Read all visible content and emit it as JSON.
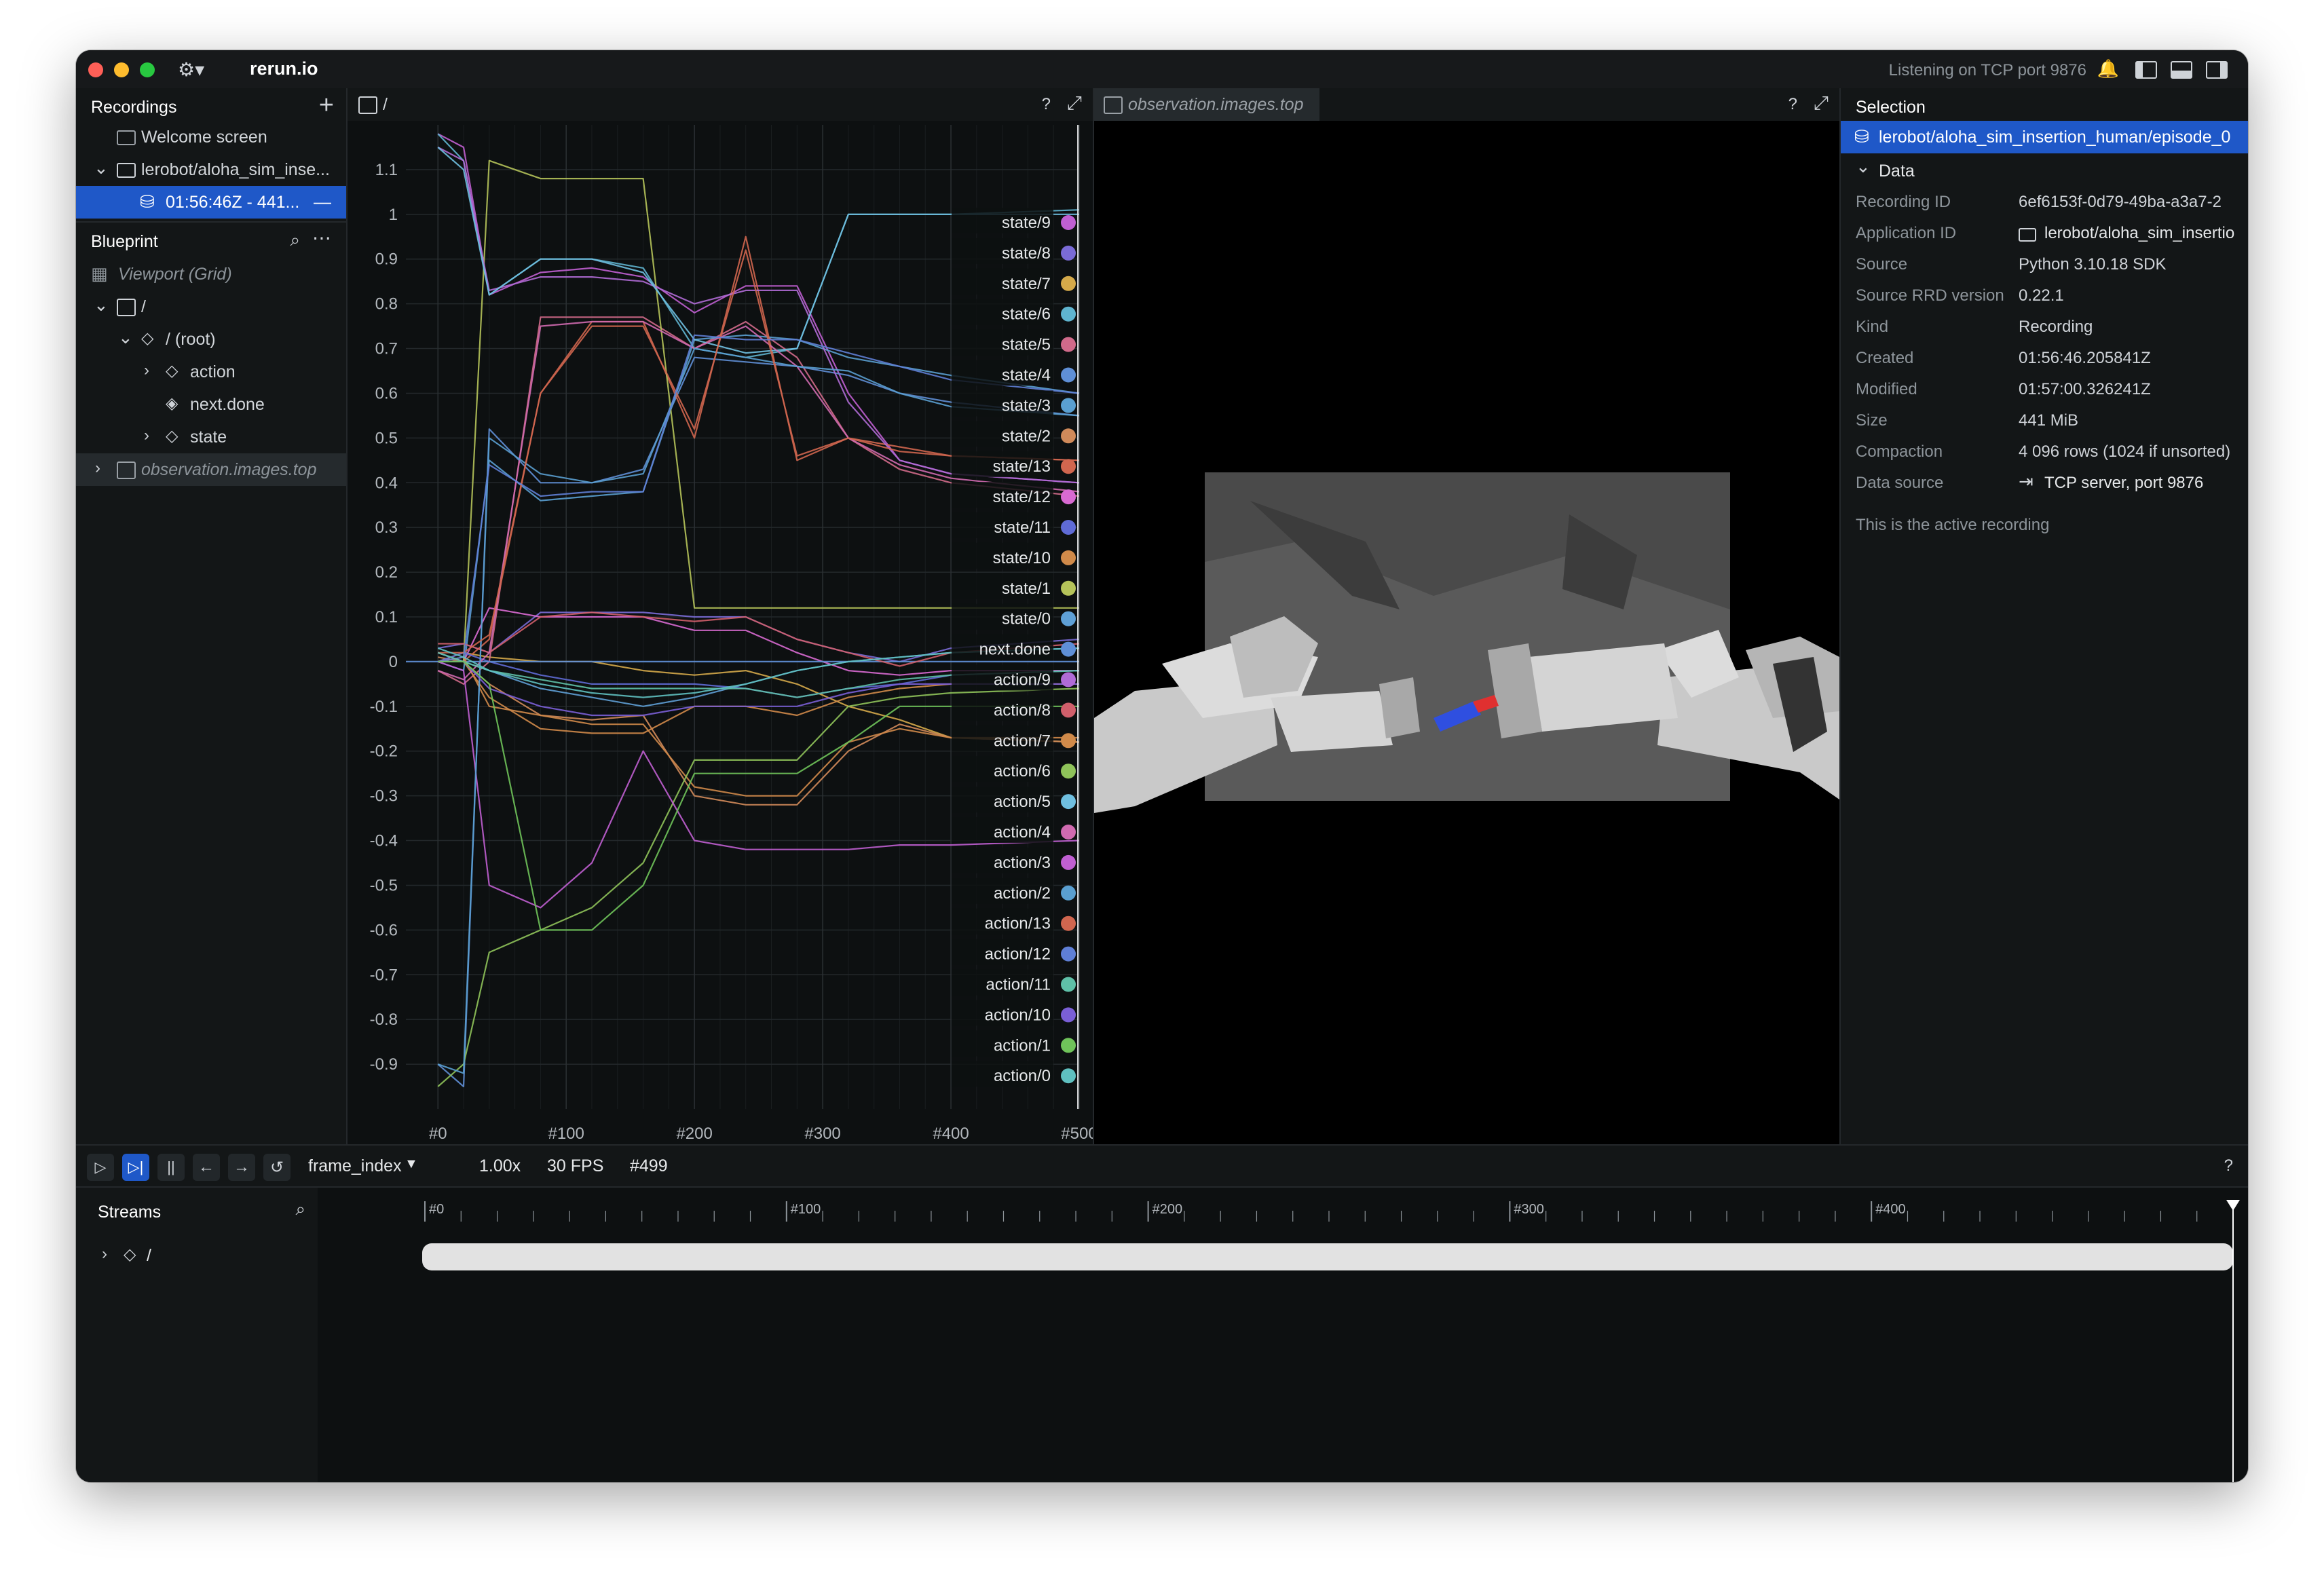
{
  "app": {
    "title": "rerun.io",
    "status": "Listening on TCP port 9876"
  },
  "recordings": {
    "title": "Recordings",
    "items": [
      {
        "label": "Welcome screen"
      },
      {
        "label": "lerobot/aloha_sim_inse..."
      },
      {
        "label": "01:56:46Z - 441..."
      }
    ]
  },
  "blueprint": {
    "title": "Blueprint",
    "items": [
      {
        "label": "Viewport (Grid)"
      },
      {
        "label": "/"
      },
      {
        "label": "/ (root)"
      },
      {
        "label": "action"
      },
      {
        "label": "next.done"
      },
      {
        "label": "state"
      },
      {
        "label": "observation.images.top"
      }
    ]
  },
  "plot_view": {
    "tab": "/",
    "help": "?"
  },
  "image_view": {
    "tab": "observation.images.top",
    "help": "?"
  },
  "chart_data": {
    "type": "line",
    "title": "",
    "xlabel": "",
    "ylabel": "",
    "xlim": [
      -25,
      500
    ],
    "ylim": [
      -1.0,
      1.2
    ],
    "x_ticks": [
      "#0",
      "#100",
      "#200",
      "#300",
      "#400",
      "#500"
    ],
    "y_ticks": [
      "1.1",
      "1",
      "0.9",
      "0.8",
      "0.7",
      "0.6",
      "0.5",
      "0.4",
      "0.3",
      "0.2",
      "0.1",
      "0",
      "-0.1",
      "-0.2",
      "-0.3",
      "-0.4",
      "-0.5",
      "-0.6",
      "-0.7",
      "-0.8",
      "-0.9"
    ],
    "grid": true,
    "legend_placement": "right",
    "series": [
      {
        "name": "state/9",
        "color": "#c05fd2",
        "x": [
          0,
          20,
          40,
          80,
          120,
          160,
          200,
          240,
          280,
          320,
          360,
          400,
          500
        ],
        "y": [
          1.18,
          1.15,
          0.82,
          0.87,
          0.88,
          0.86,
          0.78,
          0.84,
          0.84,
          0.6,
          0.45,
          0.42,
          0.4
        ]
      },
      {
        "name": "state/8",
        "color": "#7a6bd6",
        "x": [
          0,
          20,
          40,
          80,
          120,
          160,
          200,
          240,
          280,
          320,
          360,
          400,
          500
        ],
        "y": [
          0.03,
          0.04,
          0.02,
          0.11,
          0.11,
          0.11,
          0.1,
          0.1,
          0.05,
          0.02,
          0.0,
          0.03,
          0.05
        ]
      },
      {
        "name": "state/7",
        "color": "#d4a94a",
        "x": [
          0,
          20,
          40,
          80,
          120,
          160,
          200,
          240,
          280,
          320,
          360,
          400,
          500
        ],
        "y": [
          0.0,
          0.02,
          0.01,
          0.0,
          0.0,
          -0.02,
          -0.03,
          -0.02,
          -0.05,
          -0.1,
          -0.13,
          -0.17,
          -0.18
        ]
      },
      {
        "name": "state/6",
        "color": "#5fb4cf",
        "x": [
          0,
          20,
          40,
          80,
          120,
          160,
          200,
          240,
          280,
          320,
          360,
          400,
          500
        ],
        "y": [
          1.18,
          1.12,
          0.82,
          0.9,
          0.9,
          0.88,
          0.7,
          0.68,
          0.7,
          1.0,
          1.0,
          1.0,
          1.01
        ]
      },
      {
        "name": "state/5",
        "color": "#d06a8a",
        "x": [
          0,
          20,
          40,
          80,
          120,
          160,
          200,
          240,
          280,
          320,
          360,
          400,
          500
        ],
        "y": [
          -0.02,
          -0.05,
          0.0,
          0.77,
          0.77,
          0.77,
          0.7,
          0.76,
          0.68,
          0.5,
          0.43,
          0.4,
          0.37
        ]
      },
      {
        "name": "state/4",
        "color": "#5f8fd6",
        "x": [
          0,
          20,
          40,
          80,
          120,
          160,
          200,
          240,
          280,
          320,
          360,
          400,
          500
        ],
        "y": [
          -0.9,
          -0.95,
          0.52,
          0.4,
          0.4,
          0.43,
          0.68,
          0.67,
          0.66,
          0.64,
          0.6,
          0.58,
          0.55
        ]
      },
      {
        "name": "state/3",
        "color": "#5a9fd0",
        "x": [
          0,
          20,
          40,
          80,
          120,
          160,
          200,
          240,
          280,
          320,
          360,
          400,
          500
        ],
        "y": [
          0.0,
          -0.02,
          0.45,
          0.36,
          0.37,
          0.38,
          0.72,
          0.73,
          0.72,
          0.68,
          0.66,
          0.64,
          0.6
        ]
      },
      {
        "name": "state/2",
        "color": "#d08a5a",
        "x": [
          0,
          20,
          40,
          80,
          120,
          160,
          200,
          240,
          280,
          320,
          360,
          400,
          500
        ],
        "y": [
          0.01,
          0.0,
          -0.05,
          -0.12,
          -0.13,
          -0.12,
          -0.3,
          -0.32,
          -0.32,
          -0.2,
          -0.14,
          -0.17,
          -0.18
        ]
      },
      {
        "name": "state/13",
        "color": "#d0664f",
        "x": [
          0,
          20,
          40,
          80,
          120,
          160,
          200,
          240,
          280,
          320,
          360,
          400,
          500
        ],
        "y": [
          0.02,
          0.0,
          0.05,
          0.6,
          0.76,
          0.76,
          0.5,
          0.95,
          0.45,
          0.5,
          0.48,
          0.46,
          0.45
        ]
      },
      {
        "name": "state/12",
        "color": "#d86ad2",
        "x": [
          0,
          20,
          40,
          80,
          120,
          160,
          200,
          240,
          280,
          320,
          360,
          400,
          500
        ],
        "y": [
          0.02,
          0.0,
          0.12,
          0.1,
          0.1,
          0.1,
          0.07,
          0.07,
          0.02,
          -0.02,
          -0.03,
          -0.02,
          -0.02
        ]
      },
      {
        "name": "state/11",
        "color": "#5f6bd6",
        "x": [
          0,
          20,
          40,
          80,
          120,
          160,
          200,
          240,
          280,
          320,
          360,
          400,
          500
        ],
        "y": [
          0.0,
          0.02,
          0.0,
          -0.03,
          -0.05,
          -0.05,
          -0.05,
          -0.06,
          -0.08,
          -0.06,
          -0.05,
          -0.03,
          -0.02
        ]
      },
      {
        "name": "state/10",
        "color": "#d08a4a",
        "x": [
          0,
          20,
          40,
          80,
          120,
          160,
          200,
          240,
          280,
          320,
          360,
          400,
          500
        ],
        "y": [
          0.0,
          0.0,
          -0.08,
          -0.15,
          -0.16,
          -0.16,
          -0.1,
          -0.1,
          -0.12,
          -0.08,
          -0.06,
          -0.05,
          -0.05
        ]
      },
      {
        "name": "state/1",
        "color": "#b5c35a",
        "x": [
          0,
          20,
          40,
          80,
          120,
          160,
          200,
          240,
          280,
          320,
          360,
          400,
          500
        ],
        "y": [
          0.0,
          0.0,
          1.12,
          1.08,
          1.08,
          1.08,
          0.12,
          0.12,
          0.12,
          0.12,
          0.12,
          0.12,
          0.12
        ]
      },
      {
        "name": "state/0",
        "color": "#5fa0d6",
        "x": [
          0,
          20,
          40,
          80,
          120,
          160,
          200,
          240,
          280,
          320,
          360,
          400,
          500
        ],
        "y": [
          0.02,
          0.0,
          -0.02,
          -0.06,
          -0.08,
          -0.1,
          -0.08,
          -0.05,
          -0.02,
          0.0,
          0.01,
          0.02,
          0.03
        ]
      },
      {
        "name": "next.done",
        "color": "#5f8fd6",
        "x": [
          -25,
          500
        ],
        "y": [
          0.0,
          0.0
        ]
      },
      {
        "name": "action/9",
        "color": "#b06bd6",
        "x": [
          0,
          20,
          40,
          80,
          120,
          160,
          200,
          240,
          280,
          320,
          360,
          400,
          500
        ],
        "y": [
          1.15,
          1.12,
          0.83,
          0.86,
          0.86,
          0.85,
          0.8,
          0.83,
          0.83,
          0.58,
          0.45,
          0.42,
          0.4
        ]
      },
      {
        "name": "action/8",
        "color": "#d05f6b",
        "x": [
          0,
          20,
          40,
          80,
          120,
          160,
          200,
          240,
          280,
          320,
          360,
          400,
          500
        ],
        "y": [
          0.04,
          0.04,
          0.02,
          0.1,
          0.11,
          0.1,
          0.09,
          0.1,
          0.05,
          0.02,
          -0.01,
          0.02,
          0.04
        ]
      },
      {
        "name": "action/7",
        "color": "#d08a4a",
        "x": [
          0,
          20,
          40,
          80,
          120,
          160,
          200,
          240,
          280,
          320,
          360,
          400,
          500
        ],
        "y": [
          0.0,
          0.01,
          -0.1,
          -0.12,
          -0.14,
          -0.14,
          -0.28,
          -0.3,
          -0.3,
          -0.18,
          -0.15,
          -0.17,
          -0.17
        ]
      },
      {
        "name": "action/6",
        "color": "#8fc35a",
        "x": [
          0,
          20,
          40,
          80,
          120,
          160,
          200,
          240,
          280,
          320,
          360,
          400,
          500
        ],
        "y": [
          -0.95,
          -0.9,
          -0.65,
          -0.6,
          -0.55,
          -0.45,
          -0.22,
          -0.22,
          -0.22,
          -0.1,
          -0.08,
          -0.07,
          -0.06
        ]
      },
      {
        "name": "action/5",
        "color": "#6fbfe0",
        "x": [
          0,
          20,
          40,
          80,
          120,
          160,
          200,
          240,
          280,
          320,
          360,
          400,
          500
        ],
        "y": [
          1.15,
          1.1,
          0.82,
          0.9,
          0.9,
          0.87,
          0.72,
          0.69,
          0.7,
          1.0,
          1.0,
          1.0,
          1.0
        ]
      },
      {
        "name": "action/4",
        "color": "#d06ab0",
        "x": [
          0,
          20,
          40,
          80,
          120,
          160,
          200,
          240,
          280,
          320,
          360,
          400,
          500
        ],
        "y": [
          -0.02,
          -0.04,
          0.02,
          0.75,
          0.76,
          0.76,
          0.7,
          0.75,
          0.66,
          0.5,
          0.44,
          0.41,
          0.38
        ]
      },
      {
        "name": "action/3",
        "color": "#c05fd2",
        "x": [
          0,
          20,
          40,
          80,
          120,
          160,
          200,
          240,
          280,
          320,
          360,
          400,
          500
        ],
        "y": [
          0.0,
          -0.02,
          -0.5,
          -0.55,
          -0.45,
          -0.2,
          -0.4,
          -0.42,
          -0.42,
          -0.42,
          -0.41,
          -0.41,
          -0.4
        ]
      },
      {
        "name": "action/2",
        "color": "#5a9fd0",
        "x": [
          0,
          20,
          40,
          80,
          120,
          160,
          200,
          240,
          280,
          320,
          360,
          400,
          500
        ],
        "y": [
          -0.9,
          -0.92,
          0.5,
          0.42,
          0.4,
          0.42,
          0.7,
          0.68,
          0.66,
          0.65,
          0.6,
          0.57,
          0.55
        ]
      },
      {
        "name": "action/13",
        "color": "#d0664f",
        "x": [
          0,
          20,
          40,
          80,
          120,
          160,
          200,
          240,
          280,
          320,
          360,
          400,
          500
        ],
        "y": [
          0.02,
          0.02,
          0.06,
          0.6,
          0.75,
          0.75,
          0.52,
          0.92,
          0.46,
          0.5,
          0.47,
          0.46,
          0.45
        ]
      },
      {
        "name": "action/12",
        "color": "#5f7fd6",
        "x": [
          0,
          20,
          40,
          80,
          120,
          160,
          200,
          240,
          280,
          320,
          360,
          400,
          500
        ],
        "y": [
          0.0,
          0.01,
          0.44,
          0.37,
          0.38,
          0.38,
          0.73,
          0.72,
          0.72,
          0.69,
          0.66,
          0.63,
          0.6
        ]
      },
      {
        "name": "action/11",
        "color": "#5fc0a8",
        "x": [
          0,
          20,
          40,
          80,
          120,
          160,
          200,
          240,
          280,
          320,
          360,
          400,
          500
        ],
        "y": [
          0.02,
          0.0,
          -0.02,
          -0.04,
          -0.06,
          -0.06,
          -0.06,
          -0.06,
          -0.08,
          -0.06,
          -0.04,
          -0.03,
          -0.02
        ]
      },
      {
        "name": "action/10",
        "color": "#7a5fd6",
        "x": [
          0,
          20,
          40,
          80,
          120,
          160,
          200,
          240,
          280,
          320,
          360,
          400,
          500
        ],
        "y": [
          0.0,
          0.0,
          -0.06,
          -0.1,
          -0.12,
          -0.12,
          -0.1,
          -0.1,
          -0.1,
          -0.07,
          -0.05,
          -0.05,
          -0.05
        ]
      },
      {
        "name": "action/1",
        "color": "#6fc35a",
        "x": [
          0,
          20,
          40,
          80,
          120,
          160,
          200,
          240,
          280,
          320,
          360,
          400,
          500
        ],
        "y": [
          0.0,
          0.0,
          -0.05,
          -0.6,
          -0.6,
          -0.5,
          -0.25,
          -0.25,
          -0.25,
          -0.18,
          -0.1,
          -0.1,
          -0.1
        ]
      },
      {
        "name": "action/0",
        "color": "#5fc0c0",
        "x": [
          0,
          20,
          40,
          80,
          120,
          160,
          200,
          240,
          280,
          320,
          360,
          400,
          500
        ],
        "y": [
          0.03,
          0.01,
          -0.02,
          -0.05,
          -0.07,
          -0.08,
          -0.07,
          -0.05,
          -0.02,
          0.0,
          0.01,
          0.02,
          0.03
        ]
      }
    ]
  },
  "selection": {
    "title": "Selection",
    "selected": "lerobot/aloha_sim_insertion_human/episode_0",
    "section": "Data",
    "fields": [
      {
        "key": "Recording ID",
        "value": "6ef6153f-0d79-49ba-a3a7-2"
      },
      {
        "key": "Application ID",
        "value": "lerobot/aloha_sim_insertio"
      },
      {
        "key": "Source",
        "value": "Python 3.10.18 SDK"
      },
      {
        "key": "Source RRD version",
        "value": "0.22.1"
      },
      {
        "key": "Kind",
        "value": "Recording"
      },
      {
        "key": "Created",
        "value": "01:56:46.205841Z"
      },
      {
        "key": "Modified",
        "value": "01:57:00.326241Z"
      },
      {
        "key": "Size",
        "value": "441 MiB"
      },
      {
        "key": "Compaction",
        "value": "4 096 rows (1024 if unsorted)"
      },
      {
        "key": "Data source",
        "value": "TCP server, port 9876"
      }
    ],
    "note": "This is the active recording"
  },
  "timeline": {
    "timeline_name": "frame_index",
    "speed": "1.00x",
    "fps": "30 FPS",
    "current": "#499",
    "help": "?",
    "streams_title": "Streams",
    "stream_root": "/",
    "ticks": [
      "#0",
      "#100",
      "#200",
      "#300",
      "#400"
    ]
  }
}
